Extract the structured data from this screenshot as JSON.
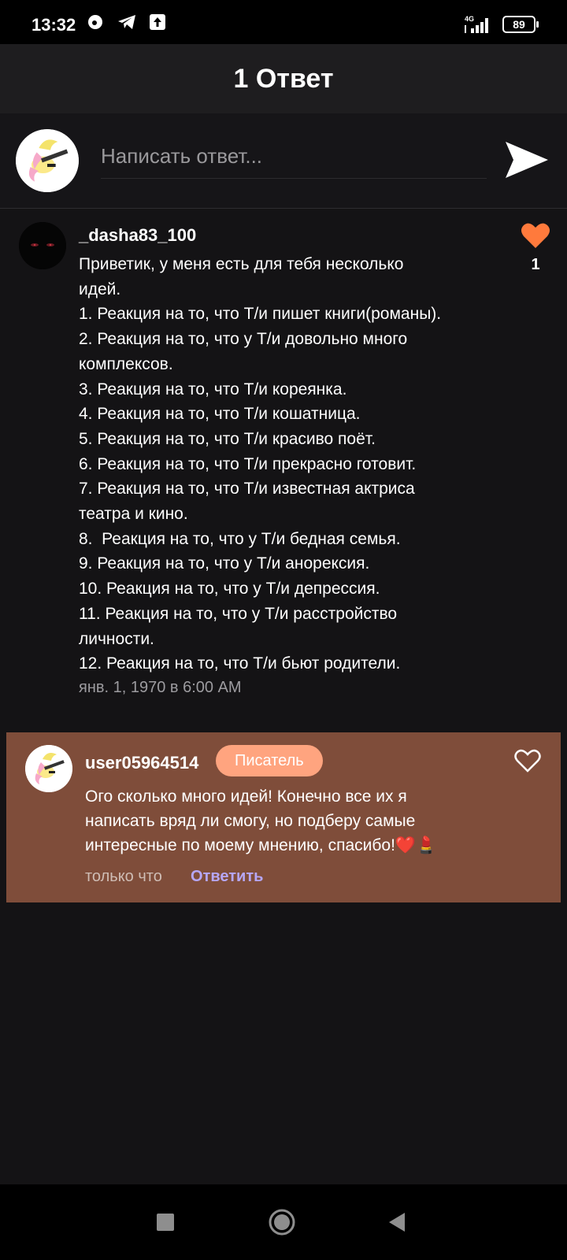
{
  "status_bar": {
    "time": "13:32",
    "network": "4G",
    "battery": "89",
    "icons": [
      "notification-icon",
      "telegram-icon",
      "upload-icon",
      "signal-icon"
    ]
  },
  "header": {
    "title": "1 Ответ"
  },
  "composer": {
    "placeholder": "Написать ответ..."
  },
  "comment": {
    "username": "_dasha83_100",
    "likes": "1",
    "lines": [
      "Приветик, у меня есть для тебя несколько",
      "идей.",
      "1. Реакция на то, что Т/и пишет книги(романы).",
      "2. Реакция на то, что у Т/и довольно много",
      "комплексов.",
      "3. Реакция на то, что Т/и кореянка.",
      "4. Реакция на то, что Т/и кошатница.",
      "5. Реакция на то, что Т/и красиво поёт.",
      "6. Реакция на то, что Т/и прекрасно готовит.",
      "7. Реакция на то, что Т/и известная актриса",
      "театра и кино.",
      "8.  Реакция на то, что у Т/и бедная семья.",
      "9. Реакция на то, что у Т/и анорексия.",
      "10. Реакция на то, что у Т/и депрессия.",
      "11. Реакция на то, что у Т/и расстройство",
      "личности.",
      "12. Реакция на то, что Т/и бьют родители."
    ],
    "timestamp": "янв. 1, 1970 в 6:00 AM"
  },
  "reply": {
    "username": "user05964514",
    "badge": "Писатель",
    "lines": [
      "Ого сколько много идей! Конечно все их я",
      "написать вряд ли смогу, но подберу самые",
      "интересные по моему мнению, спасибо!❤️💄"
    ],
    "time": "только что",
    "action": "Ответить"
  },
  "colors": {
    "accent_like": "#ff7a3c",
    "reply_card_bg": "#7f4d3a",
    "badge_bg": "#ffa47f",
    "reply_action": "#b6a7f7"
  }
}
